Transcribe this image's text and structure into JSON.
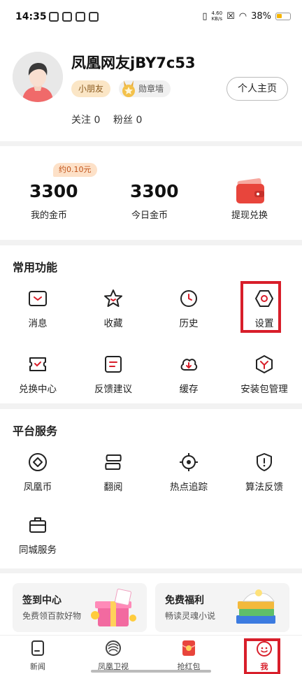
{
  "status_bar": {
    "time": "14:35",
    "net_speed": "4.60\nKB/s",
    "battery": "38%",
    "battery_level": 0.38
  },
  "profile": {
    "username": "凤凰网友jBY7c53",
    "level_tag": "小朋友",
    "medal_tag": "勋章墙",
    "home_button": "个人主页",
    "follow_label": "关注",
    "follow_count": "0",
    "fans_label": "粉丝",
    "fans_count": "0"
  },
  "coins": {
    "badge": "约0.10元",
    "my_coins_value": "3300",
    "my_coins_label": "我的金币",
    "today_coins_value": "3300",
    "today_coins_label": "今日金币",
    "withdraw_label": "提现兑换"
  },
  "common_functions": {
    "title": "常用功能",
    "items": [
      {
        "label": "消息",
        "icon": "message-icon"
      },
      {
        "label": "收藏",
        "icon": "star-icon"
      },
      {
        "label": "历史",
        "icon": "clock-icon"
      },
      {
        "label": "设置",
        "icon": "settings-hexagon-icon"
      },
      {
        "label": "兑换中心",
        "icon": "ticket-icon"
      },
      {
        "label": "反馈建议",
        "icon": "feedback-icon"
      },
      {
        "label": "缓存",
        "icon": "cloud-download-icon"
      },
      {
        "label": "安装包管理",
        "icon": "package-icon"
      }
    ]
  },
  "platform_services": {
    "title": "平台服务",
    "items": [
      {
        "label": "凤凰币",
        "icon": "coin-diamond-icon"
      },
      {
        "label": "翻阅",
        "icon": "flip-icon"
      },
      {
        "label": "热点追踪",
        "icon": "target-icon"
      },
      {
        "label": "算法反馈",
        "icon": "shield-alert-icon"
      },
      {
        "label": "同城服务",
        "icon": "briefcase-icon"
      }
    ]
  },
  "promos": [
    {
      "title": "签到中心",
      "subtitle": "免费领百款好物"
    },
    {
      "title": "免费福利",
      "subtitle": "畅读灵魂小说"
    }
  ],
  "bottom_nav": [
    {
      "label": "新闻",
      "icon": "news-icon"
    },
    {
      "label": "凤凰卫视",
      "icon": "phoenix-tv-icon"
    },
    {
      "label": "抢红包",
      "icon": "red-packet-icon"
    },
    {
      "label": "我",
      "icon": "me-icon"
    }
  ],
  "colors": {
    "accent": "#d81e2a",
    "level_tag_bg": "#fbe6c6",
    "coin_badge_bg": "#fde1c8"
  }
}
